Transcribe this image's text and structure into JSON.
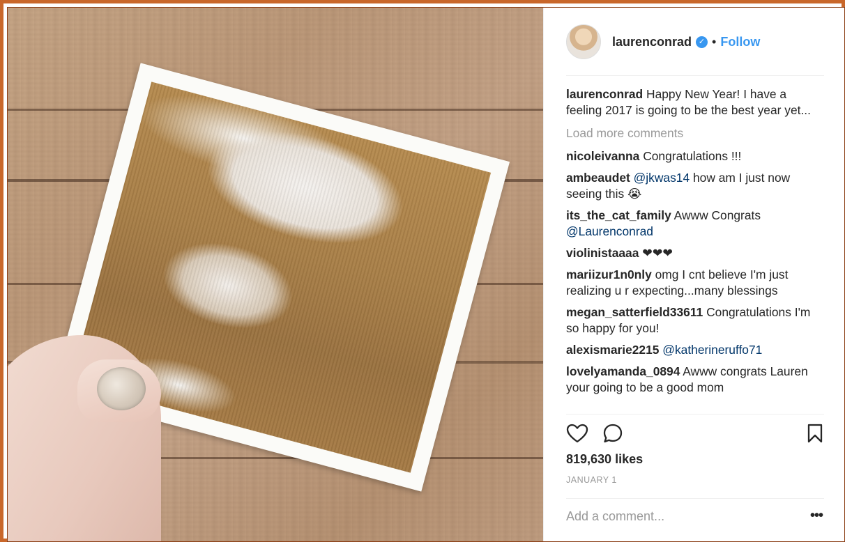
{
  "post": {
    "username": "laurenconrad",
    "verified_icon": "verified-badge-icon",
    "follow_label": "Follow",
    "separator": "•"
  },
  "caption": {
    "username": "laurenconrad",
    "text": "Happy New Year! I have a feeling 2017 is going to be the best year yet..."
  },
  "load_more_label": "Load more comments",
  "comments": [
    {
      "user": "nicoleivanna",
      "text": "Congratulations !!!",
      "mention": ""
    },
    {
      "user": "ambeaudet",
      "mention": "@jkwas14",
      "text": "how am I just now seeing this 😭"
    },
    {
      "user": "its_the_cat_family",
      "text": "Awww Congrats",
      "mention": "@Laurenconrad"
    },
    {
      "user": "violinistaaaa",
      "text": "❤❤❤",
      "mention": ""
    },
    {
      "user": "mariizur1n0nly",
      "text": "omg I cnt believe I'm just realizing u r expecting...many blessings",
      "mention": ""
    },
    {
      "user": "megan_satterfield33611",
      "text": "Congratulations I'm so happy for you!",
      "mention": ""
    },
    {
      "user": "alexismarie2215",
      "mention": "@katherineruffo71",
      "text": ""
    },
    {
      "user": "lovelyamanda_0894",
      "text": "Awww congrats Lauren your going to be a good mom",
      "mention": ""
    }
  ],
  "likes_text": "819,630 likes",
  "date_text": "JANUARY 1",
  "add_comment_placeholder": "Add a comment...",
  "more_options_label": "•••",
  "icons": {
    "like": "heart-icon",
    "comment": "comment-bubble-icon",
    "save": "bookmark-icon"
  }
}
